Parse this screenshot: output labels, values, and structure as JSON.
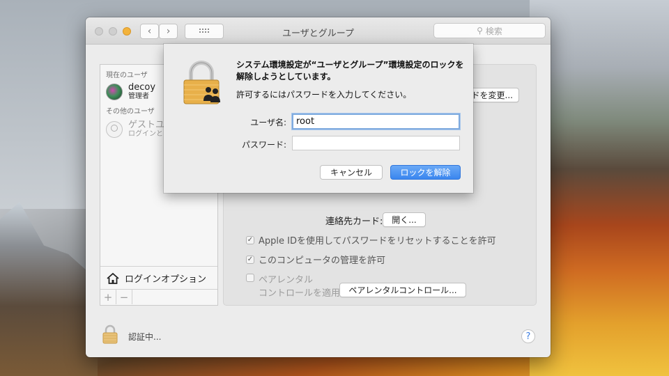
{
  "window": {
    "title": "ユーザとグループ",
    "search_placeholder": "検索"
  },
  "sidebar": {
    "current_users_header": "現在のユーザ",
    "current_user": {
      "name": "decoy",
      "role": "管理者"
    },
    "other_users_header": "その他のユーザ",
    "guest_user": {
      "name": "ゲストユ",
      "note": "ログインと"
    },
    "login_options_label": "ログインオプション",
    "add_label": "+",
    "remove_label": "−"
  },
  "content": {
    "change_button_partial": "ドを変更...",
    "contacts_card_label": "連絡先カード:",
    "open_button": "開く...",
    "checkbox_appleid": "Apple IDを使用してパスワードをリセットすることを許可",
    "checkbox_admin": "このコンピュータの管理を許可",
    "parental_line1": "ペアレンタル",
    "parental_line2": "コントロールを適用",
    "parental_button": "ペアレンタルコントロール..."
  },
  "footer": {
    "auth_status": "認証中...",
    "help_label": "?"
  },
  "auth_sheet": {
    "message": "システム環境設定が“ユーザとグループ”環境設定のロックを解除しようとしています。",
    "instruction": "許可するにはパスワードを入力してください。",
    "username_label": "ユーザ名:",
    "username_value": "root",
    "password_label": "パスワード:",
    "password_value": "",
    "cancel_label": "キャンセル",
    "unlock_label": "ロックを解除"
  }
}
